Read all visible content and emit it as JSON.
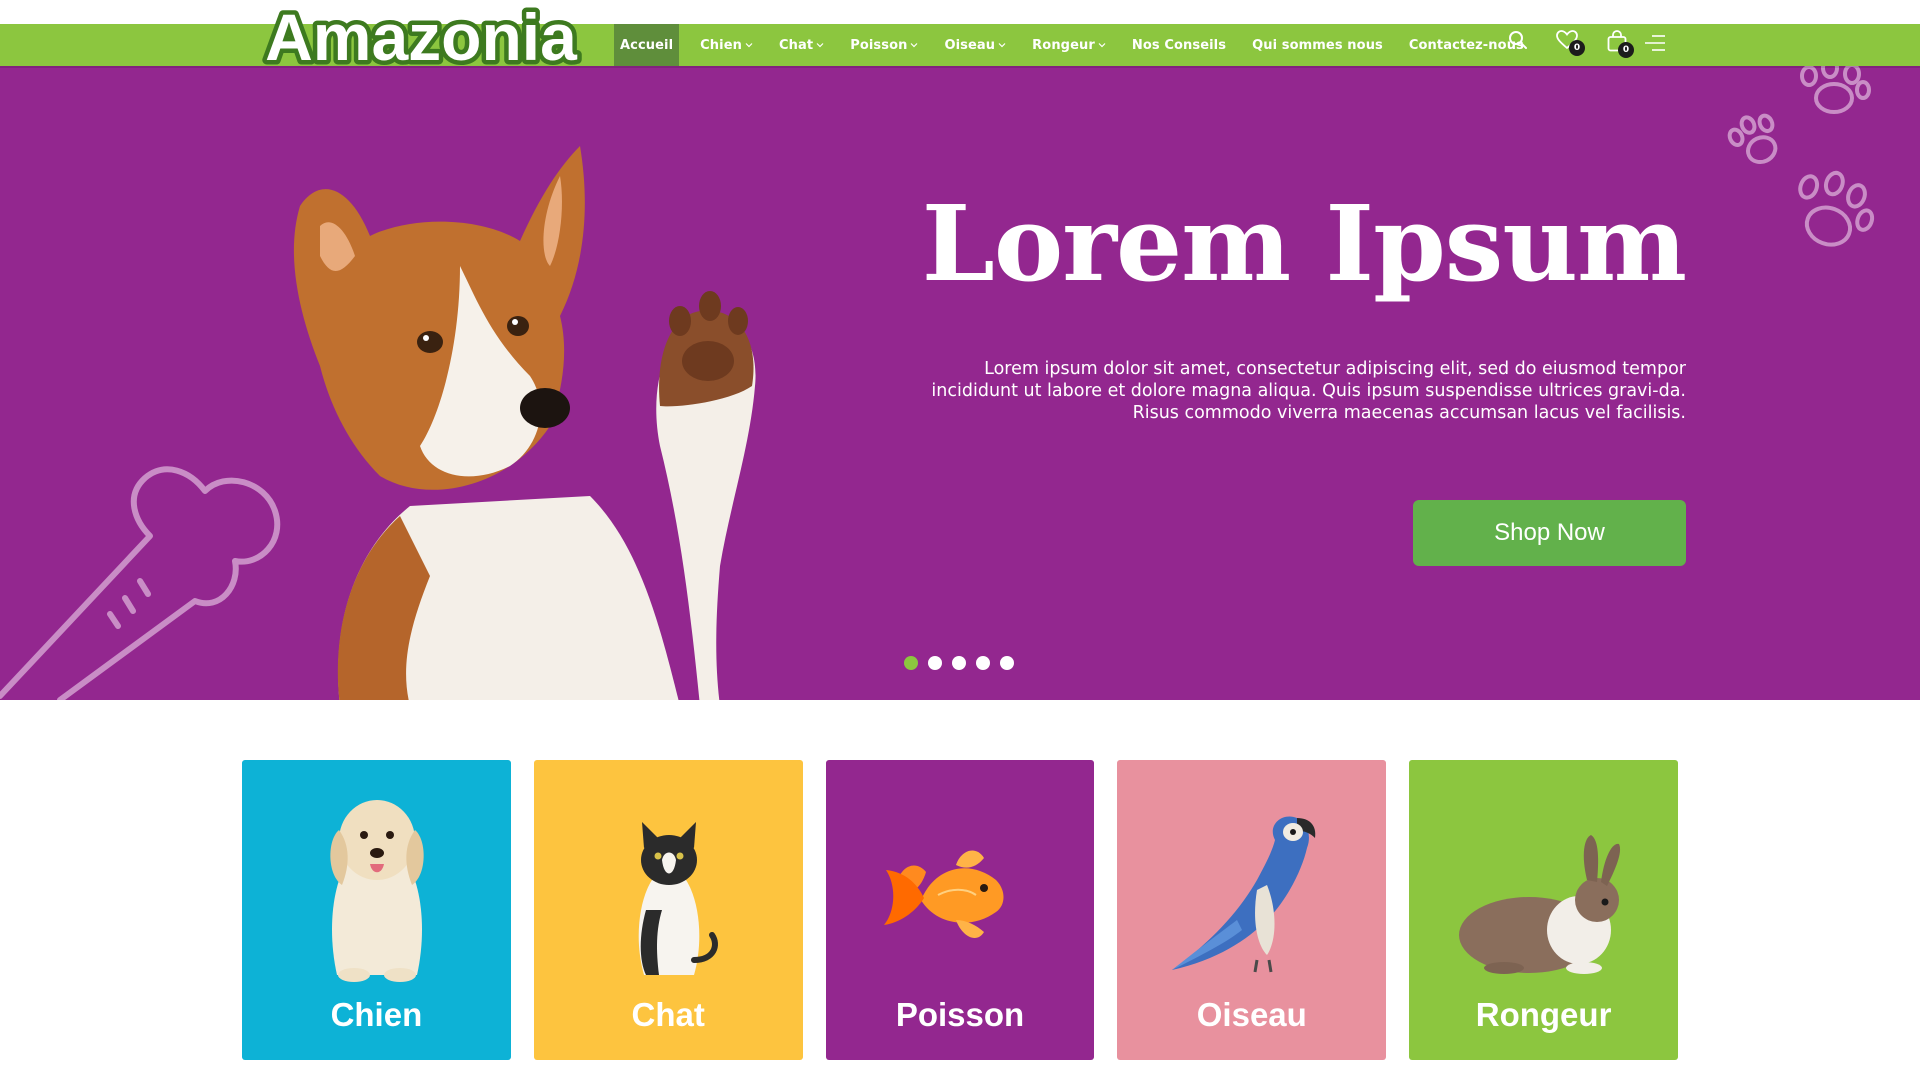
{
  "brand": {
    "logo_text": "Amazonia"
  },
  "nav": {
    "items": [
      {
        "label": "Accueil",
        "dropdown": false,
        "active": true
      },
      {
        "label": "Chien",
        "dropdown": true,
        "active": false
      },
      {
        "label": "Chat",
        "dropdown": true,
        "active": false
      },
      {
        "label": "Poisson",
        "dropdown": true,
        "active": false
      },
      {
        "label": "Oiseau",
        "dropdown": true,
        "active": false
      },
      {
        "label": "Rongeur",
        "dropdown": true,
        "active": false
      },
      {
        "label": "Nos Conseils",
        "dropdown": false,
        "active": false
      },
      {
        "label": "Qui sommes nous",
        "dropdown": false,
        "active": false
      },
      {
        "label": "Contactez-nous",
        "dropdown": false,
        "active": false
      }
    ]
  },
  "header_icons": {
    "search": "search-icon",
    "wishlist": {
      "icon": "heart-icon",
      "count": "0"
    },
    "cart": {
      "icon": "shopping-bag-icon",
      "count": "0"
    },
    "menu": "menu-icon"
  },
  "hero": {
    "title": "Lorem Ipsum",
    "text": "Lorem ipsum dolor sit amet, consectetur adipiscing elit, sed do eiusmod tempor incididunt ut labore et dolore magna aliqua. Quis ipsum suspendisse ultrices gravi-da. Risus commodo viverra maecenas accumsan lacus vel facilisis.",
    "button": "Shop Now",
    "slides": 5,
    "active_slide": 1
  },
  "categories": [
    {
      "label": "Chien",
      "color": "#0db2d6",
      "icon": "dog-icon"
    },
    {
      "label": "Chat",
      "color": "#fdc43f",
      "icon": "cat-icon"
    },
    {
      "label": "Poisson",
      "color": "#93278f",
      "icon": "fish-icon"
    },
    {
      "label": "Oiseau",
      "color": "#e8919e",
      "icon": "parrot-icon"
    },
    {
      "label": "Rongeur",
      "color": "#8cc63f",
      "icon": "rabbit-icon"
    }
  ],
  "colors": {
    "header": "#8cc63f",
    "nav_active": "#5f8e3b",
    "hero_bg": "#93278f",
    "button": "#62b14b",
    "dot_active": "#8cc63f"
  }
}
